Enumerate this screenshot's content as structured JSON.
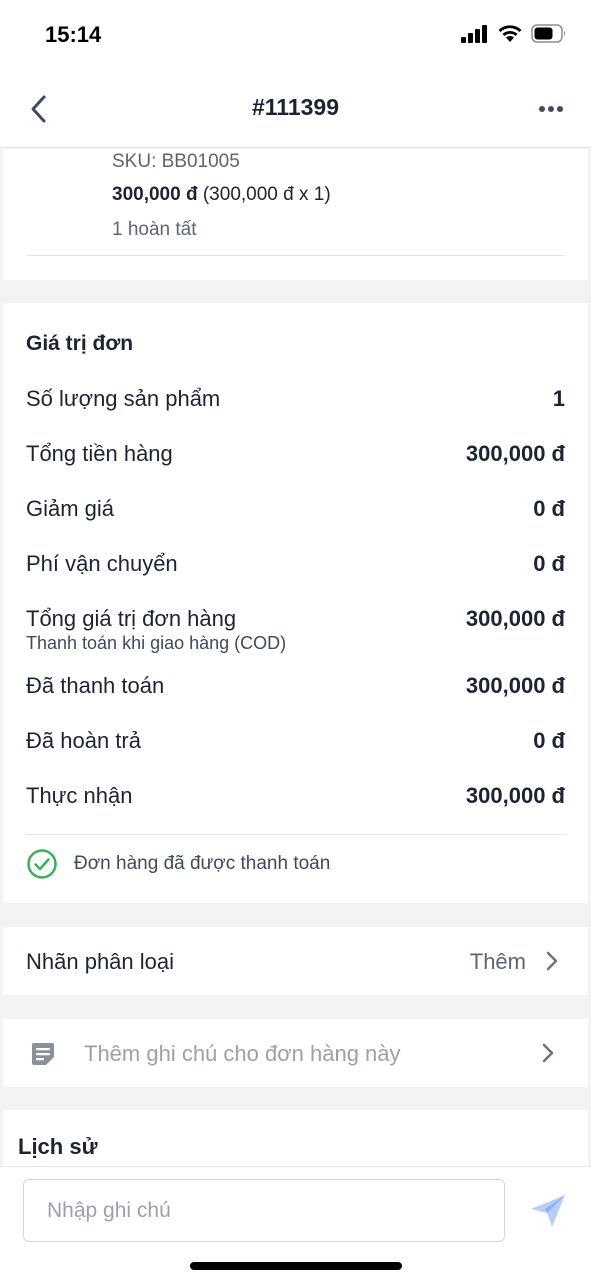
{
  "status_bar": {
    "time": "15:14"
  },
  "nav": {
    "title": "#111399"
  },
  "product": {
    "sku": "SKU: BB01005",
    "price_total": "300,000 đ",
    "price_breakdown": "(300,000 đ x 1)",
    "fulfillment_status": "1 hoàn tất"
  },
  "order_summary": {
    "title": "Giá trị đơn",
    "rows": [
      {
        "label": "Số lượng sản phẩm",
        "value": "1"
      },
      {
        "label": "Tổng tiền hàng",
        "value": "300,000 đ"
      },
      {
        "label": "Giảm giá",
        "value": "0 đ"
      },
      {
        "label": "Phí vận chuyển",
        "value": "0 đ"
      },
      {
        "label": "Tổng giá trị đơn hàng",
        "value": "300,000 đ",
        "sub": "Thanh toán khi giao hàng (COD)"
      },
      {
        "label": "Đã thanh toán",
        "value": "300,000 đ"
      },
      {
        "label": "Đã hoàn trả",
        "value": "0 đ"
      },
      {
        "label": "Thực nhận",
        "value": "300,000 đ"
      }
    ],
    "payment_status": "Đơn hàng đã được thanh toán"
  },
  "labels": {
    "label": "Nhãn phân loại",
    "action": "Thêm"
  },
  "note": {
    "placeholder": "Thêm ghi chú cho đơn hàng này"
  },
  "history": {
    "title": "Lịch sử"
  },
  "composer": {
    "placeholder": "Nhập ghi chú"
  },
  "colors": {
    "accent": "#5b8def",
    "success": "#3dae5a",
    "text_primary": "#1c2434",
    "text_secondary": "#5c6573",
    "placeholder": "#9aa1ab",
    "background": "#f2f3f5"
  },
  "icons": {
    "back": "chevron-left-icon",
    "more": "more-horizontal-icon",
    "paid": "check-circle-icon",
    "note": "note-icon",
    "send": "send-icon",
    "chevron": "chevron-right-icon"
  }
}
